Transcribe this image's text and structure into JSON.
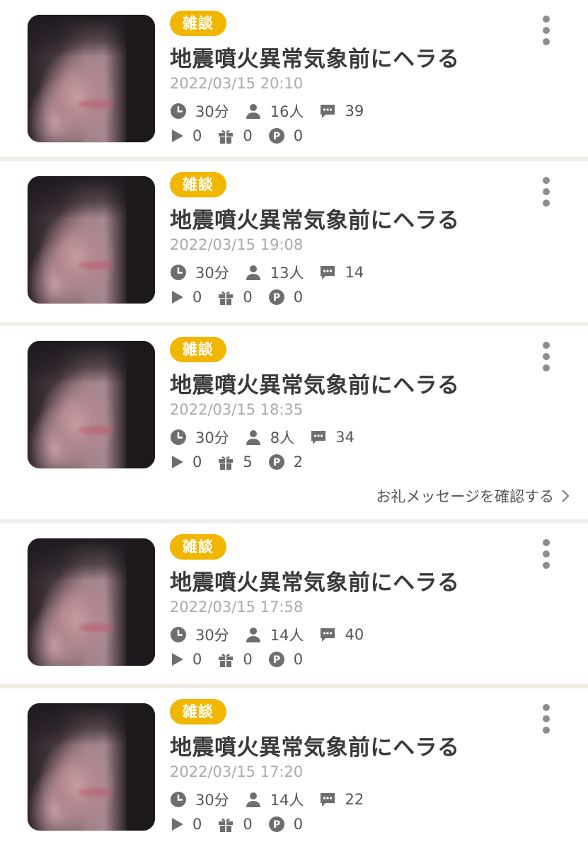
{
  "items": [
    {
      "category": "雑談",
      "title": "地震噴火異常気象前にヘラる",
      "datetime": "2022/03/15 20:10",
      "duration": "30分",
      "listeners": "16人",
      "comments": "39",
      "plays": "0",
      "gifts": "0",
      "points": "0"
    },
    {
      "category": "雑談",
      "title": "地震噴火異常気象前にヘラる",
      "datetime": "2022/03/15 19:08",
      "duration": "30分",
      "listeners": "13人",
      "comments": "14",
      "plays": "0",
      "gifts": "0",
      "points": "0"
    },
    {
      "category": "雑談",
      "title": "地震噴火異常気象前にヘラる",
      "datetime": "2022/03/15 18:35",
      "duration": "30分",
      "listeners": "8人",
      "comments": "34",
      "plays": "0",
      "gifts": "5",
      "points": "2",
      "thanks_link": "お礼メッセージを確認する"
    },
    {
      "category": "雑談",
      "title": "地震噴火異常気象前にヘラる",
      "datetime": "2022/03/15 17:58",
      "duration": "30分",
      "listeners": "14人",
      "comments": "40",
      "plays": "0",
      "gifts": "0",
      "points": "0"
    },
    {
      "category": "雑談",
      "title": "地震噴火異常気象前にヘラる",
      "datetime": "2022/03/15 17:20",
      "duration": "30分",
      "listeners": "14人",
      "comments": "22",
      "plays": "0",
      "gifts": "0",
      "points": "0"
    }
  ],
  "colors": {
    "badge": "#f1b600",
    "icon": "#6e6e6e",
    "date": "#aaaaaa",
    "separator": "#f1eeea"
  },
  "icons": [
    "clock-icon",
    "person-icon",
    "comment-icon",
    "play-icon",
    "gift-icon",
    "point-icon",
    "more-vertical-icon",
    "chevron-right-icon"
  ]
}
